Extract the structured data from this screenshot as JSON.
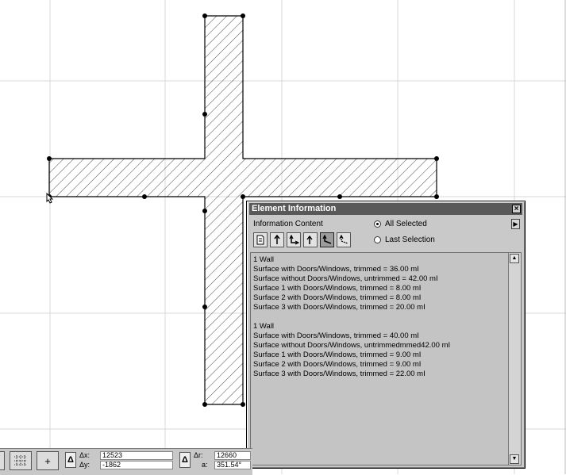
{
  "palette": {
    "title": "Element Information",
    "information_content_label": "Information Content",
    "radio_all_selected": "All Selected",
    "radio_last_selection": "Last Selection",
    "close_glyph": "×",
    "expand_glyph": "▶",
    "tools": [
      {
        "icon": "document-icon"
      },
      {
        "icon": "arrow-up-icon"
      },
      {
        "icon": "arrow-up-right-icon"
      },
      {
        "icon": "arrow-up-small-icon"
      },
      {
        "icon": "arrow-corner-icon",
        "pressed": true
      },
      {
        "icon": "arrow-corner-dotted-icon"
      }
    ],
    "lines": [
      "1 Wall",
      "Surface with Doors/Windows, trimmed = 36.00 mI",
      "Surface without Doors/Windows, untrimmed = 42.00 mI",
      "Surface 1 with Doors/Windows, trimmed = 8.00 mI",
      "Surface 2 with Doors/Windows, trimmed = 8.00 mI",
      "Surface 3 with Doors/Windows, trimmed = 20.00 mI",
      "",
      "1 Wall",
      "Surface with Doors/Windows, trimmed = 40.00 mI",
      "Surface without Doors/Windows, untrimmedmmed42.00 mI",
      "Surface 1 with Doors/Windows, trimmed = 9.00 mI",
      "Surface 2 with Doors/Windows, trimmed = 9.00 mI",
      "Surface 3 with Doors/Windows, trimmed = 22.00 mI"
    ]
  },
  "statusbar": {
    "dx_label": "Δx:",
    "dx_value": "12523",
    "dy_label": "Δy:",
    "dy_value": "-1862",
    "dr_label": "Δr:",
    "dr_value": "12660",
    "a_label": "a:",
    "a_value": "351.54°",
    "delta_glyph": "Δ",
    "plus_glyph": "+"
  }
}
